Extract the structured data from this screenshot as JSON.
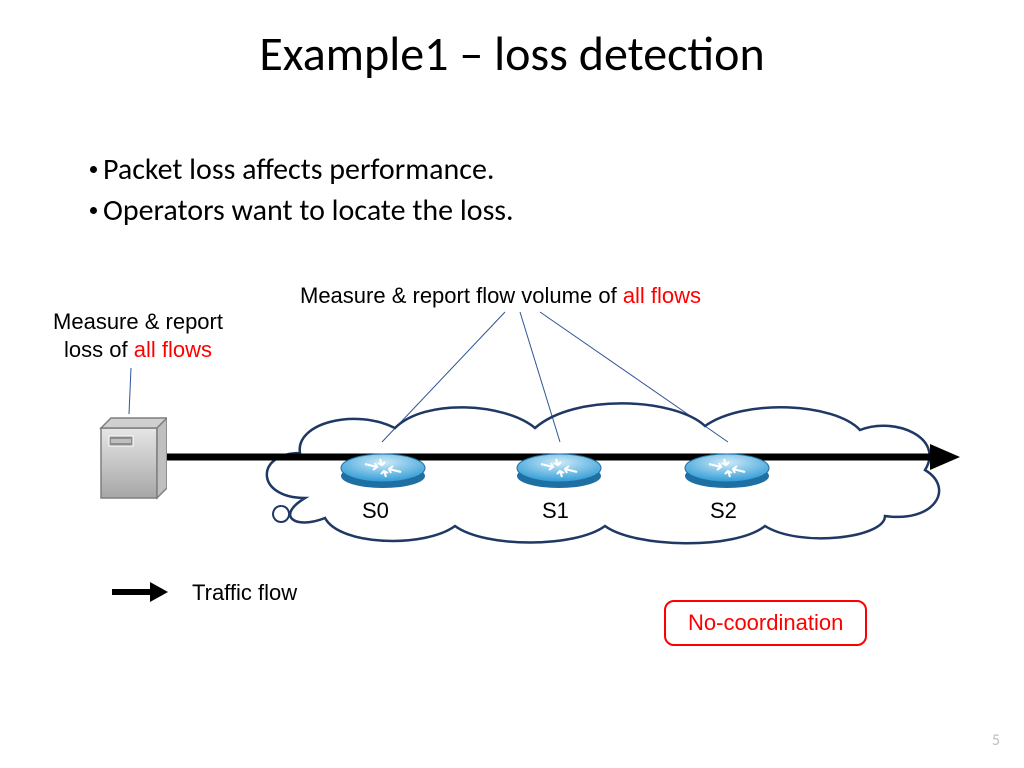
{
  "title": "Example1 – loss detection",
  "bullets": {
    "b1": "Packet loss affects performance.",
    "b2": "Operators want to locate the loss."
  },
  "leftCaption": {
    "line1": "Measure & report",
    "line2_pre": "loss of ",
    "line2_red": "all flows"
  },
  "topCaption": {
    "pre": "Measure & report flow volume of ",
    "red": "all flows"
  },
  "routers": {
    "s0": "S0",
    "s1": "S1",
    "s2": "S2"
  },
  "legend": "Traffic flow",
  "noCoord": "No-coordination",
  "pageNumber": "5"
}
